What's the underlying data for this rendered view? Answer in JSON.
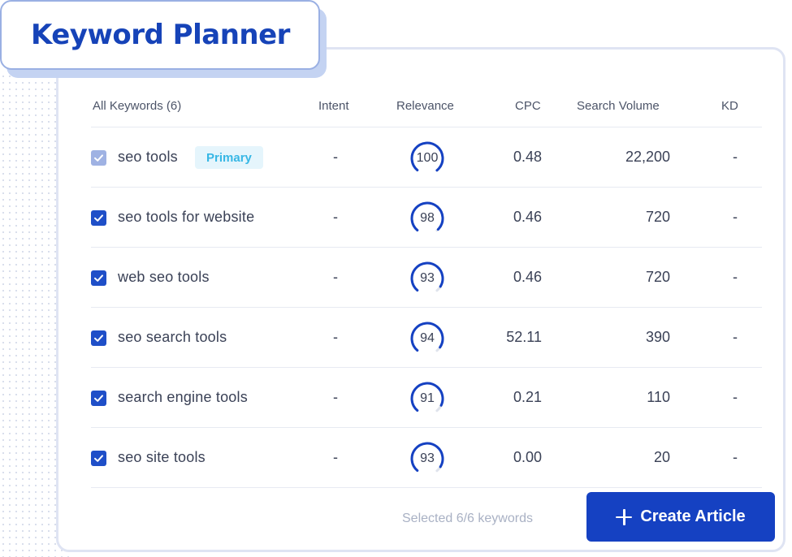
{
  "title": "Keyword Planner",
  "columns": {
    "keyword": "All Keywords (6)",
    "intent": "Intent",
    "relevance": "Relevance",
    "cpc": "CPC",
    "volume": "Search Volume",
    "kd": "KD"
  },
  "rows": [
    {
      "keyword": "seo tools",
      "badge": "Primary",
      "checked": true,
      "disabled": true,
      "intent": "-",
      "relevance": "100",
      "cpc": "0.48",
      "volume": "22,200",
      "kd": "-"
    },
    {
      "keyword": "seo tools for website",
      "checked": true,
      "intent": "-",
      "relevance": "98",
      "cpc": "0.46",
      "volume": "720",
      "kd": "-"
    },
    {
      "keyword": "web seo tools",
      "checked": true,
      "intent": "-",
      "relevance": "93",
      "cpc": "0.46",
      "volume": "720",
      "kd": "-"
    },
    {
      "keyword": "seo search tools",
      "checked": true,
      "intent": "-",
      "relevance": "94",
      "cpc": "52.11",
      "volume": "390",
      "kd": "-"
    },
    {
      "keyword": "search engine tools",
      "checked": true,
      "intent": "-",
      "relevance": "91",
      "cpc": "0.21",
      "volume": "110",
      "kd": "-"
    },
    {
      "keyword": "seo site tools",
      "checked": true,
      "intent": "-",
      "relevance": "93",
      "cpc": "0.00",
      "volume": "20",
      "kd": "-"
    }
  ],
  "footer": {
    "selected_text": "Selected 6/6 keywords",
    "create_label": "Create Article",
    "create_icon": "plus-icon"
  },
  "colors": {
    "accent": "#1541c2",
    "title": "#1643b8",
    "badge_text": "#37b7e5",
    "badge_bg": "#e5f5fc",
    "gauge_track": "#dfe3ec"
  }
}
